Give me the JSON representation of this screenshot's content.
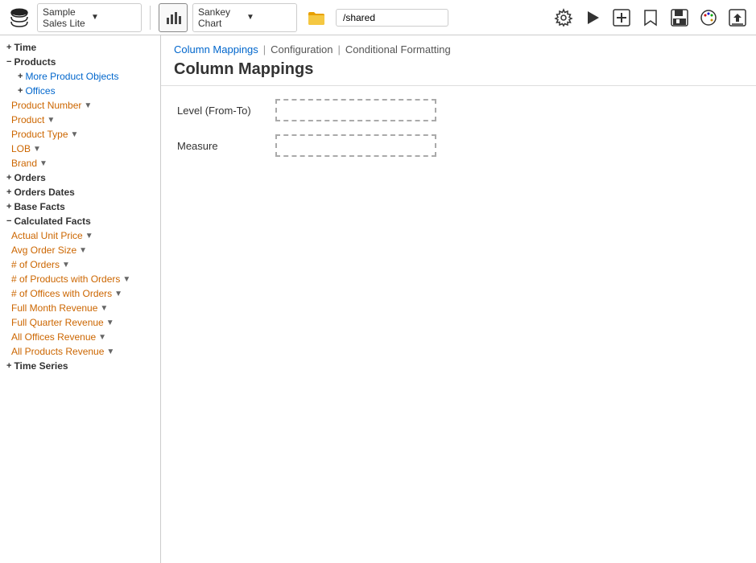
{
  "toolbar": {
    "dataset_label": "Sample Sales Lite",
    "chart_type_label": "Sankey Chart",
    "path_value": "/shared",
    "chevron": "▼"
  },
  "sidebar": {
    "sections": [
      {
        "id": "time",
        "label": "Time",
        "type": "collapsed",
        "indent": 0
      },
      {
        "id": "products",
        "label": "Products",
        "type": "expanded",
        "indent": 0
      },
      {
        "id": "more-product-objects",
        "label": "More Product Objects",
        "type": "collapsed",
        "indent": 1,
        "color": "blue"
      },
      {
        "id": "offices",
        "label": "Offices",
        "type": "collapsed",
        "indent": 1,
        "color": "blue"
      },
      {
        "id": "product-number",
        "label": "Product Number",
        "type": "field",
        "indent": 1,
        "color": "orange",
        "hasFilter": true
      },
      {
        "id": "product",
        "label": "Product",
        "type": "field",
        "indent": 1,
        "color": "orange",
        "hasFilter": true
      },
      {
        "id": "product-type",
        "label": "Product Type",
        "type": "field",
        "indent": 1,
        "color": "orange",
        "hasFilter": true
      },
      {
        "id": "lob",
        "label": "LOB",
        "type": "field",
        "indent": 1,
        "color": "orange",
        "hasFilter": true
      },
      {
        "id": "brand",
        "label": "Brand",
        "type": "field",
        "indent": 1,
        "color": "orange",
        "hasFilter": true
      },
      {
        "id": "orders",
        "label": "Orders",
        "type": "collapsed",
        "indent": 0
      },
      {
        "id": "orders-dates",
        "label": "Orders Dates",
        "type": "collapsed",
        "indent": 0
      },
      {
        "id": "base-facts",
        "label": "Base Facts",
        "type": "collapsed",
        "indent": 0
      },
      {
        "id": "calculated-facts",
        "label": "Calculated Facts",
        "type": "expanded",
        "indent": 0
      },
      {
        "id": "actual-unit-price",
        "label": "Actual Unit Price",
        "type": "field",
        "indent": 1,
        "color": "orange",
        "hasFilter": true
      },
      {
        "id": "avg-order-size",
        "label": "Avg Order Size",
        "type": "field",
        "indent": 1,
        "color": "orange",
        "hasFilter": true
      },
      {
        "id": "num-orders",
        "label": "# of Orders",
        "type": "field",
        "indent": 1,
        "color": "orange",
        "hasFilter": true
      },
      {
        "id": "num-products-with-orders",
        "label": "# of Products with Orders",
        "type": "field",
        "indent": 1,
        "color": "orange",
        "hasFilter": true
      },
      {
        "id": "num-offices-with-orders",
        "label": "# of Offices with Orders",
        "type": "field",
        "indent": 1,
        "color": "orange",
        "hasFilter": true
      },
      {
        "id": "full-month-revenue",
        "label": "Full Month Revenue",
        "type": "field",
        "indent": 1,
        "color": "orange",
        "hasFilter": true
      },
      {
        "id": "full-quarter-revenue",
        "label": "Full Quarter Revenue",
        "type": "field",
        "indent": 1,
        "color": "orange",
        "hasFilter": true
      },
      {
        "id": "all-offices-revenue",
        "label": "All Offices Revenue",
        "type": "field",
        "indent": 1,
        "color": "orange",
        "hasFilter": true
      },
      {
        "id": "all-products-revenue",
        "label": "All Products Revenue",
        "type": "field",
        "indent": 1,
        "color": "orange",
        "hasFilter": true
      },
      {
        "id": "time-series",
        "label": "Time Series",
        "type": "collapsed",
        "indent": 0
      }
    ]
  },
  "content": {
    "tabs": [
      {
        "id": "column-mappings",
        "label": "Column Mappings",
        "active": true
      },
      {
        "id": "configuration",
        "label": "Configuration",
        "active": false
      },
      {
        "id": "conditional-formatting",
        "label": "Conditional Formatting",
        "active": false
      }
    ],
    "title": "Column Mappings",
    "form": {
      "level_label": "Level (From-To)",
      "measure_label": "Measure"
    }
  }
}
